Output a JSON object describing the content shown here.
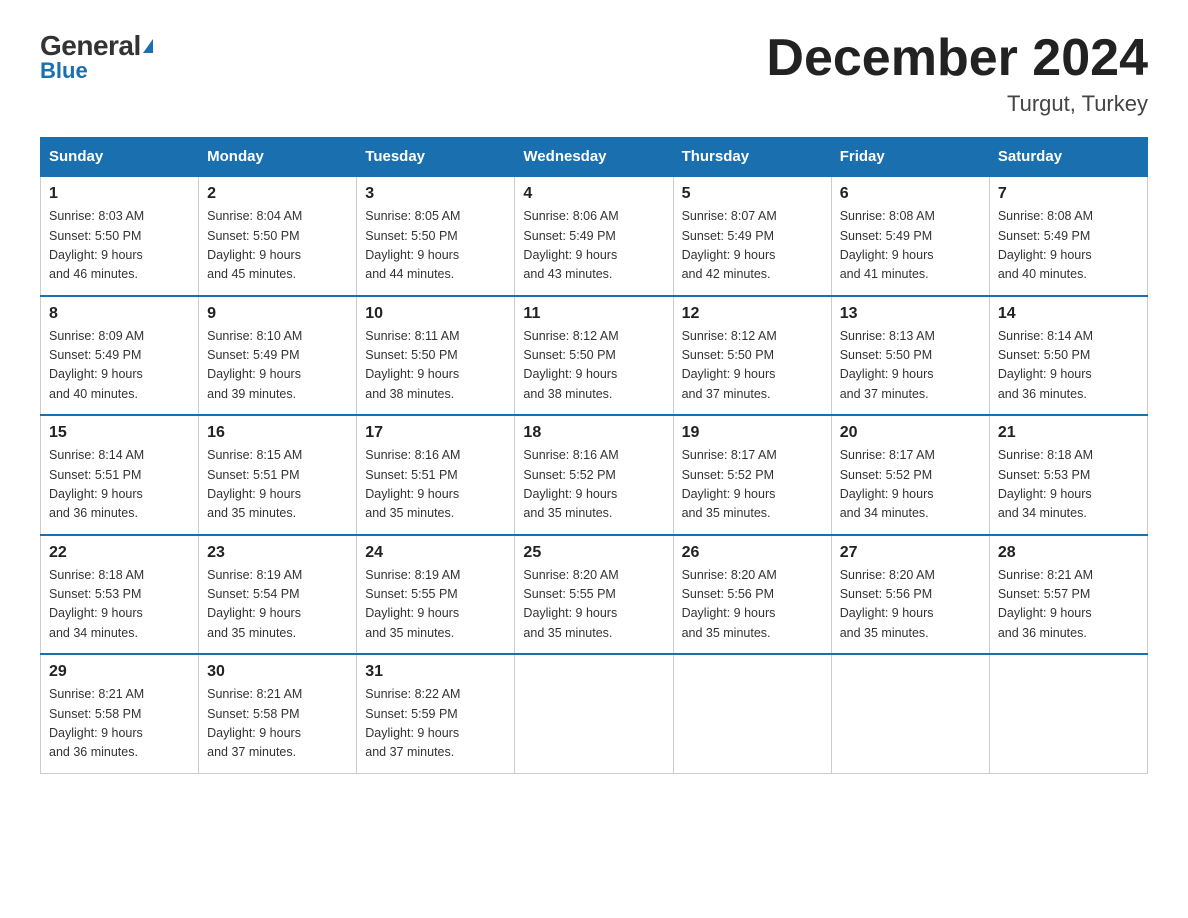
{
  "header": {
    "logo_general": "General",
    "logo_blue": "Blue",
    "month_title": "December 2024",
    "location": "Turgut, Turkey"
  },
  "days_of_week": [
    "Sunday",
    "Monday",
    "Tuesday",
    "Wednesday",
    "Thursday",
    "Friday",
    "Saturday"
  ],
  "weeks": [
    [
      {
        "day": "1",
        "sunrise": "8:03 AM",
        "sunset": "5:50 PM",
        "daylight": "9 hours and 46 minutes."
      },
      {
        "day": "2",
        "sunrise": "8:04 AM",
        "sunset": "5:50 PM",
        "daylight": "9 hours and 45 minutes."
      },
      {
        "day": "3",
        "sunrise": "8:05 AM",
        "sunset": "5:50 PM",
        "daylight": "9 hours and 44 minutes."
      },
      {
        "day": "4",
        "sunrise": "8:06 AM",
        "sunset": "5:49 PM",
        "daylight": "9 hours and 43 minutes."
      },
      {
        "day": "5",
        "sunrise": "8:07 AM",
        "sunset": "5:49 PM",
        "daylight": "9 hours and 42 minutes."
      },
      {
        "day": "6",
        "sunrise": "8:08 AM",
        "sunset": "5:49 PM",
        "daylight": "9 hours and 41 minutes."
      },
      {
        "day": "7",
        "sunrise": "8:08 AM",
        "sunset": "5:49 PM",
        "daylight": "9 hours and 40 minutes."
      }
    ],
    [
      {
        "day": "8",
        "sunrise": "8:09 AM",
        "sunset": "5:49 PM",
        "daylight": "9 hours and 40 minutes."
      },
      {
        "day": "9",
        "sunrise": "8:10 AM",
        "sunset": "5:49 PM",
        "daylight": "9 hours and 39 minutes."
      },
      {
        "day": "10",
        "sunrise": "8:11 AM",
        "sunset": "5:50 PM",
        "daylight": "9 hours and 38 minutes."
      },
      {
        "day": "11",
        "sunrise": "8:12 AM",
        "sunset": "5:50 PM",
        "daylight": "9 hours and 38 minutes."
      },
      {
        "day": "12",
        "sunrise": "8:12 AM",
        "sunset": "5:50 PM",
        "daylight": "9 hours and 37 minutes."
      },
      {
        "day": "13",
        "sunrise": "8:13 AM",
        "sunset": "5:50 PM",
        "daylight": "9 hours and 37 minutes."
      },
      {
        "day": "14",
        "sunrise": "8:14 AM",
        "sunset": "5:50 PM",
        "daylight": "9 hours and 36 minutes."
      }
    ],
    [
      {
        "day": "15",
        "sunrise": "8:14 AM",
        "sunset": "5:51 PM",
        "daylight": "9 hours and 36 minutes."
      },
      {
        "day": "16",
        "sunrise": "8:15 AM",
        "sunset": "5:51 PM",
        "daylight": "9 hours and 35 minutes."
      },
      {
        "day": "17",
        "sunrise": "8:16 AM",
        "sunset": "5:51 PM",
        "daylight": "9 hours and 35 minutes."
      },
      {
        "day": "18",
        "sunrise": "8:16 AM",
        "sunset": "5:52 PM",
        "daylight": "9 hours and 35 minutes."
      },
      {
        "day": "19",
        "sunrise": "8:17 AM",
        "sunset": "5:52 PM",
        "daylight": "9 hours and 35 minutes."
      },
      {
        "day": "20",
        "sunrise": "8:17 AM",
        "sunset": "5:52 PM",
        "daylight": "9 hours and 34 minutes."
      },
      {
        "day": "21",
        "sunrise": "8:18 AM",
        "sunset": "5:53 PM",
        "daylight": "9 hours and 34 minutes."
      }
    ],
    [
      {
        "day": "22",
        "sunrise": "8:18 AM",
        "sunset": "5:53 PM",
        "daylight": "9 hours and 34 minutes."
      },
      {
        "day": "23",
        "sunrise": "8:19 AM",
        "sunset": "5:54 PM",
        "daylight": "9 hours and 35 minutes."
      },
      {
        "day": "24",
        "sunrise": "8:19 AM",
        "sunset": "5:55 PM",
        "daylight": "9 hours and 35 minutes."
      },
      {
        "day": "25",
        "sunrise": "8:20 AM",
        "sunset": "5:55 PM",
        "daylight": "9 hours and 35 minutes."
      },
      {
        "day": "26",
        "sunrise": "8:20 AM",
        "sunset": "5:56 PM",
        "daylight": "9 hours and 35 minutes."
      },
      {
        "day": "27",
        "sunrise": "8:20 AM",
        "sunset": "5:56 PM",
        "daylight": "9 hours and 35 minutes."
      },
      {
        "day": "28",
        "sunrise": "8:21 AM",
        "sunset": "5:57 PM",
        "daylight": "9 hours and 36 minutes."
      }
    ],
    [
      {
        "day": "29",
        "sunrise": "8:21 AM",
        "sunset": "5:58 PM",
        "daylight": "9 hours and 36 minutes."
      },
      {
        "day": "30",
        "sunrise": "8:21 AM",
        "sunset": "5:58 PM",
        "daylight": "9 hours and 37 minutes."
      },
      {
        "day": "31",
        "sunrise": "8:22 AM",
        "sunset": "5:59 PM",
        "daylight": "9 hours and 37 minutes."
      },
      null,
      null,
      null,
      null
    ]
  ],
  "labels": {
    "sunrise": "Sunrise: ",
    "sunset": "Sunset: ",
    "daylight": "Daylight: "
  }
}
